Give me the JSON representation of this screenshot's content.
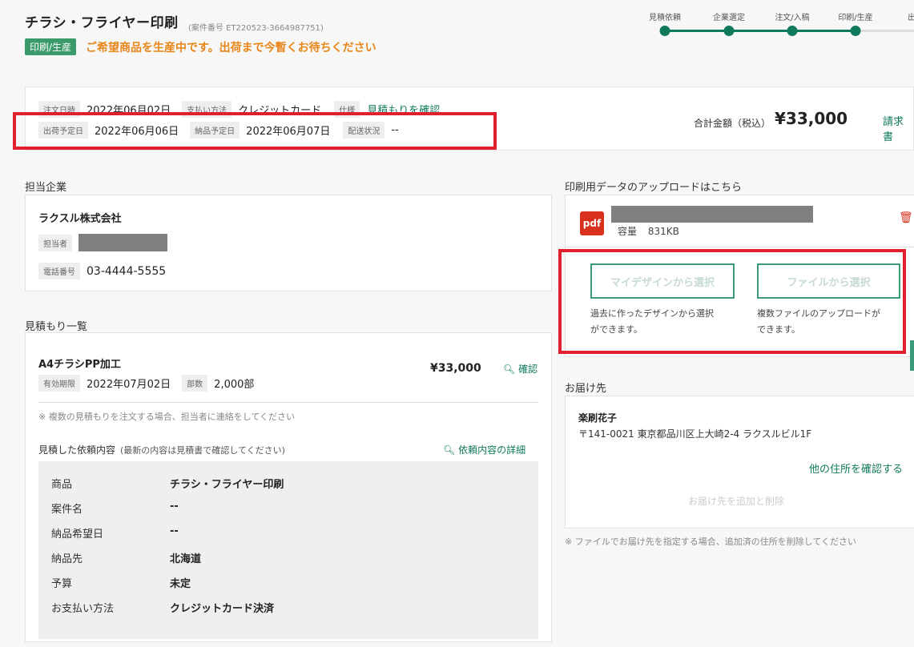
{
  "header": {
    "title": "チラシ・フライヤー印刷",
    "case_no": "(案件番号 ET220523-3664987751)",
    "status_badge": "印刷/生産",
    "status_message": "ご希望商品を生産中です。出荷まで今暫くお待ちください"
  },
  "progress": {
    "steps": [
      "見積依頼",
      "企業選定",
      "注文/入稿",
      "印刷/生産",
      "出"
    ],
    "completed": 4
  },
  "summary": {
    "order_date_label": "注文日時",
    "order_date": "2022年06月02日",
    "payment_label": "支払い方法",
    "payment": "クレジットカード",
    "spec_label": "仕様",
    "spec_link": "見積もりを確認",
    "ship_date_label": "出荷予定日",
    "ship_date": "2022年06月06日",
    "delivery_date_label": "納品予定日",
    "delivery_date": "2022年06月07日",
    "delivery_status_label": "配送状況",
    "delivery_status": "--",
    "total_label": "合計金額（税込）",
    "total": "¥33,000",
    "invoice_link": "請求書"
  },
  "company": {
    "section_title": "担当企業",
    "name": "ラクスル株式会社",
    "person_label": "担当者",
    "phone_label": "電話番号",
    "phone": "03-4444-5555"
  },
  "quotes": {
    "section_title": "見積もり一覧",
    "item_title": "A4チラシPP加工",
    "expiry_label": "有効期限",
    "expiry": "2022年07月02日",
    "qty_label": "部数",
    "qty": "2,000部",
    "price": "¥33,000",
    "confirm": "確認",
    "note": "※ 複数の見積もりを注文する場合、担当者に連絡をしてください",
    "req_title": "見積した依頼内容",
    "req_sub": "(最新の内容は見積書で確認してください)",
    "req_link": "依頼内容の詳細",
    "rows": [
      {
        "k": "商品",
        "v": "チラシ・フライヤー印刷"
      },
      {
        "k": "案件名",
        "v": "--"
      },
      {
        "k": "納品希望日",
        "v": "--"
      },
      {
        "k": "納品先",
        "v": "北海道"
      },
      {
        "k": "予算",
        "v": "未定"
      },
      {
        "k": "お支払い方法",
        "v": "クレジットカード決済"
      }
    ]
  },
  "upload": {
    "section_title": "印刷用データのアップロードはこちら",
    "pdf_label": "pdf",
    "size_label": "容量",
    "size": "831KB",
    "btn_mydesign": "マイデザインから選択",
    "btn_mydesign_desc1": "過去に作ったデザインから選択",
    "btn_mydesign_desc2": "ができます。",
    "btn_file": "ファイルから選択",
    "btn_file_desc1": "複数ファイルのアップロードが",
    "btn_file_desc2": "できます。"
  },
  "delivery": {
    "section_title": "お届け先",
    "name": "楽刷花子",
    "address": "〒141-0021 東京都品川区上大崎2-4 ラクスルビル1F",
    "other_link": "他の住所を確認する",
    "add_delete": "お届け先を追加と削除",
    "note": "※ ファイルでお届け先を指定する場合、追加済の住所を削除してください"
  },
  "colors": {
    "accent": "#0f7a5c",
    "warning": "#e8861a",
    "highlight": "#e0202e",
    "pdf": "#d8321f"
  }
}
